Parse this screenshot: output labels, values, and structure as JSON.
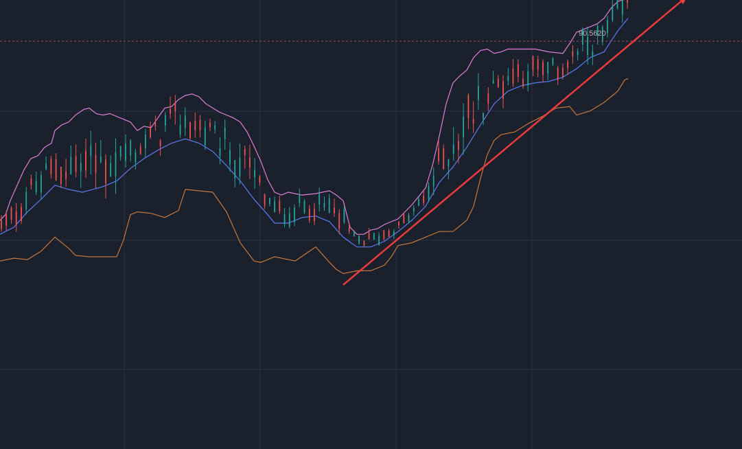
{
  "colors": {
    "background": "#1b202d",
    "grid": "#283041",
    "up_candle": "#26a69a",
    "down_candle": "#ef5350",
    "upper_band": "#e07fd8",
    "middle_band": "#5b7cf0",
    "lower_band": "#c8783a",
    "trend_arrow": "#ee3b3b",
    "price_line": "#a0505a",
    "price_label": "#b2b5be"
  },
  "price_marker": {
    "text": "90.5620"
  },
  "chart_data": {
    "type": "candlestick",
    "indicator": "bollinger-bands",
    "grid": true,
    "ylim": [
      61.5,
      93.5
    ],
    "current_price": 90.562,
    "bars": 127,
    "upper_band_points": [
      [
        0,
        77.8
      ],
      [
        8,
        78.2
      ],
      [
        15,
        79.2
      ],
      [
        25,
        80.3
      ],
      [
        35,
        81.4
      ],
      [
        45,
        82.2
      ],
      [
        55,
        82.4
      ],
      [
        65,
        83.0
      ],
      [
        75,
        83.3
      ],
      [
        80,
        84.2
      ],
      [
        90,
        84.6
      ],
      [
        100,
        84.8
      ],
      [
        110,
        85.3
      ],
      [
        122,
        85.7
      ],
      [
        130,
        85.8
      ],
      [
        140,
        85.4
      ],
      [
        150,
        85.3
      ],
      [
        160,
        85.4
      ],
      [
        170,
        85.2
      ],
      [
        180,
        85.0
      ],
      [
        190,
        84.8
      ],
      [
        200,
        84.2
      ],
      [
        210,
        84.5
      ],
      [
        220,
        84.4
      ],
      [
        230,
        85.1
      ],
      [
        240,
        85.8
      ],
      [
        250,
        85.9
      ],
      [
        260,
        86.4
      ],
      [
        270,
        86.7
      ],
      [
        280,
        86.8
      ],
      [
        290,
        86.6
      ],
      [
        300,
        86.1
      ],
      [
        310,
        85.8
      ],
      [
        320,
        85.5
      ],
      [
        340,
        85.1
      ],
      [
        350,
        84.8
      ],
      [
        360,
        84.1
      ],
      [
        370,
        83.1
      ],
      [
        380,
        82.0
      ],
      [
        390,
        80.7
      ],
      [
        400,
        79.8
      ],
      [
        410,
        79.6
      ],
      [
        420,
        79.8
      ],
      [
        440,
        79.6
      ],
      [
        460,
        79.7
      ],
      [
        480,
        79.9
      ],
      [
        490,
        79.6
      ],
      [
        500,
        79.2
      ],
      [
        510,
        77.3
      ],
      [
        520,
        76.8
      ],
      [
        530,
        76.8
      ],
      [
        540,
        77.1
      ],
      [
        550,
        77.2
      ],
      [
        560,
        77.5
      ],
      [
        580,
        77.9
      ],
      [
        600,
        78.9
      ],
      [
        620,
        80.1
      ],
      [
        630,
        81.7
      ],
      [
        640,
        83.8
      ],
      [
        650,
        86.1
      ],
      [
        660,
        87.6
      ],
      [
        670,
        88.1
      ],
      [
        680,
        88.5
      ],
      [
        690,
        89.4
      ],
      [
        700,
        89.9
      ],
      [
        710,
        90.0
      ],
      [
        720,
        89.7
      ],
      [
        730,
        89.8
      ],
      [
        740,
        90.0
      ],
      [
        760,
        90.0
      ],
      [
        780,
        90.0
      ],
      [
        800,
        89.8
      ],
      [
        820,
        89.7
      ],
      [
        830,
        90.4
      ],
      [
        840,
        91.2
      ],
      [
        860,
        91.6
      ],
      [
        870,
        91.8
      ],
      [
        880,
        92.2
      ],
      [
        890,
        92.9
      ],
      [
        900,
        93.4
      ],
      [
        915,
        93.6
      ]
    ],
    "middle_band_points": [
      [
        0,
        76.8
      ],
      [
        20,
        77.3
      ],
      [
        40,
        78.4
      ],
      [
        60,
        79.3
      ],
      [
        80,
        80.3
      ],
      [
        100,
        80.0
      ],
      [
        120,
        79.8
      ],
      [
        150,
        80.2
      ],
      [
        170,
        80.6
      ],
      [
        190,
        81.5
      ],
      [
        210,
        82.2
      ],
      [
        230,
        82.8
      ],
      [
        250,
        83.3
      ],
      [
        270,
        83.6
      ],
      [
        290,
        83.3
      ],
      [
        310,
        82.7
      ],
      [
        330,
        81.7
      ],
      [
        350,
        80.6
      ],
      [
        370,
        79.3
      ],
      [
        390,
        78.2
      ],
      [
        400,
        77.6
      ],
      [
        420,
        77.6
      ],
      [
        440,
        78.0
      ],
      [
        460,
        78.1
      ],
      [
        480,
        77.7
      ],
      [
        500,
        76.6
      ],
      [
        520,
        75.9
      ],
      [
        540,
        75.9
      ],
      [
        560,
        76.3
      ],
      [
        580,
        77.0
      ],
      [
        600,
        77.8
      ],
      [
        620,
        78.8
      ],
      [
        640,
        80.5
      ],
      [
        660,
        81.6
      ],
      [
        680,
        83.0
      ],
      [
        700,
        84.6
      ],
      [
        720,
        86.1
      ],
      [
        740,
        87.0
      ],
      [
        760,
        87.4
      ],
      [
        780,
        87.6
      ],
      [
        800,
        87.7
      ],
      [
        820,
        88.0
      ],
      [
        840,
        88.6
      ],
      [
        860,
        89.4
      ],
      [
        880,
        89.8
      ],
      [
        900,
        91.3
      ],
      [
        915,
        92.2
      ]
    ],
    "lower_band_points": [
      [
        0,
        74.9
      ],
      [
        20,
        75.1
      ],
      [
        40,
        75.0
      ],
      [
        60,
        75.6
      ],
      [
        80,
        76.6
      ],
      [
        100,
        75.8
      ],
      [
        110,
        75.3
      ],
      [
        130,
        75.2
      ],
      [
        170,
        75.2
      ],
      [
        180,
        76.4
      ],
      [
        190,
        78.2
      ],
      [
        200,
        78.4
      ],
      [
        220,
        78.3
      ],
      [
        240,
        78.0
      ],
      [
        260,
        78.5
      ],
      [
        270,
        80.0
      ],
      [
        290,
        79.9
      ],
      [
        310,
        79.8
      ],
      [
        330,
        78.4
      ],
      [
        350,
        76.2
      ],
      [
        370,
        74.9
      ],
      [
        380,
        74.8
      ],
      [
        400,
        75.2
      ],
      [
        430,
        74.9
      ],
      [
        460,
        75.9
      ],
      [
        480,
        74.8
      ],
      [
        490,
        74.3
      ],
      [
        500,
        74.0
      ],
      [
        520,
        74.2
      ],
      [
        540,
        74.2
      ],
      [
        560,
        74.6
      ],
      [
        570,
        75.2
      ],
      [
        580,
        76.0
      ],
      [
        600,
        76.2
      ],
      [
        620,
        76.6
      ],
      [
        640,
        77.0
      ],
      [
        660,
        77.0
      ],
      [
        680,
        77.8
      ],
      [
        690,
        78.8
      ],
      [
        700,
        80.8
      ],
      [
        710,
        82.5
      ],
      [
        720,
        83.5
      ],
      [
        730,
        83.9
      ],
      [
        750,
        84.1
      ],
      [
        770,
        84.7
      ],
      [
        790,
        85.2
      ],
      [
        810,
        85.8
      ],
      [
        830,
        85.9
      ],
      [
        840,
        85.3
      ],
      [
        860,
        85.6
      ],
      [
        880,
        86.2
      ],
      [
        900,
        87.0
      ],
      [
        910,
        87.8
      ],
      [
        915,
        87.9
      ]
    ],
    "trend_arrow": {
      "from": [
        500,
        73.2
      ],
      "to": [
        1002,
        93.8
      ]
    }
  }
}
